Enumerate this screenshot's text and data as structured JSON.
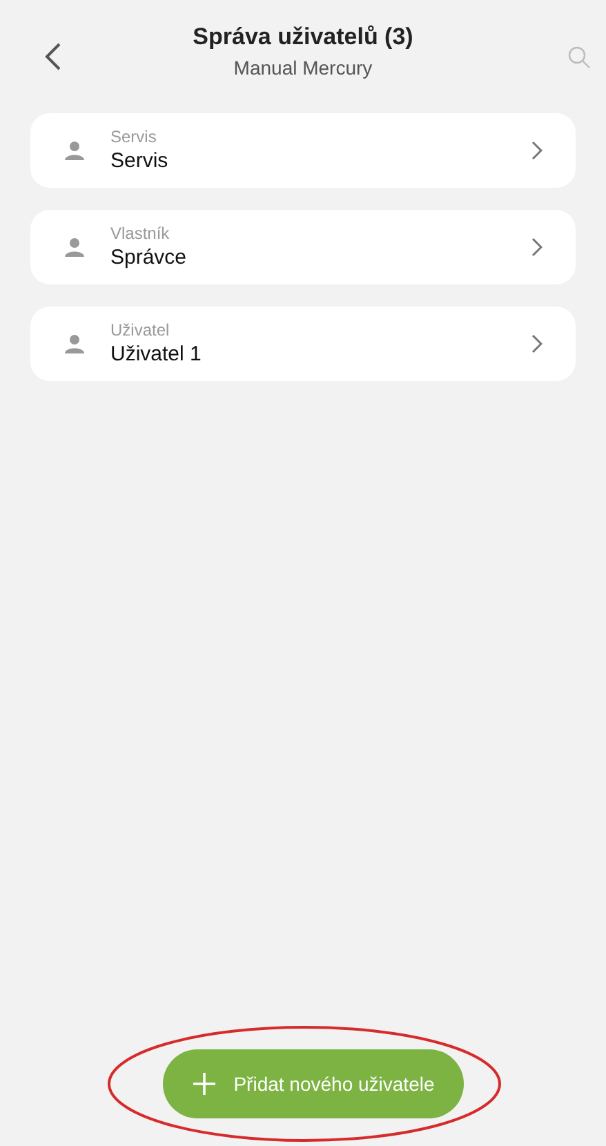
{
  "header": {
    "title": "Správa uživatelů (3)",
    "subtitle": "Manual Mercury"
  },
  "users": [
    {
      "role": "Servis",
      "name": "Servis"
    },
    {
      "role": "Vlastník",
      "name": "Správce"
    },
    {
      "role": "Uživatel",
      "name": "Uživatel 1"
    }
  ],
  "add_button": {
    "label": "Přidat nového uživatele",
    "highlighted": true
  }
}
